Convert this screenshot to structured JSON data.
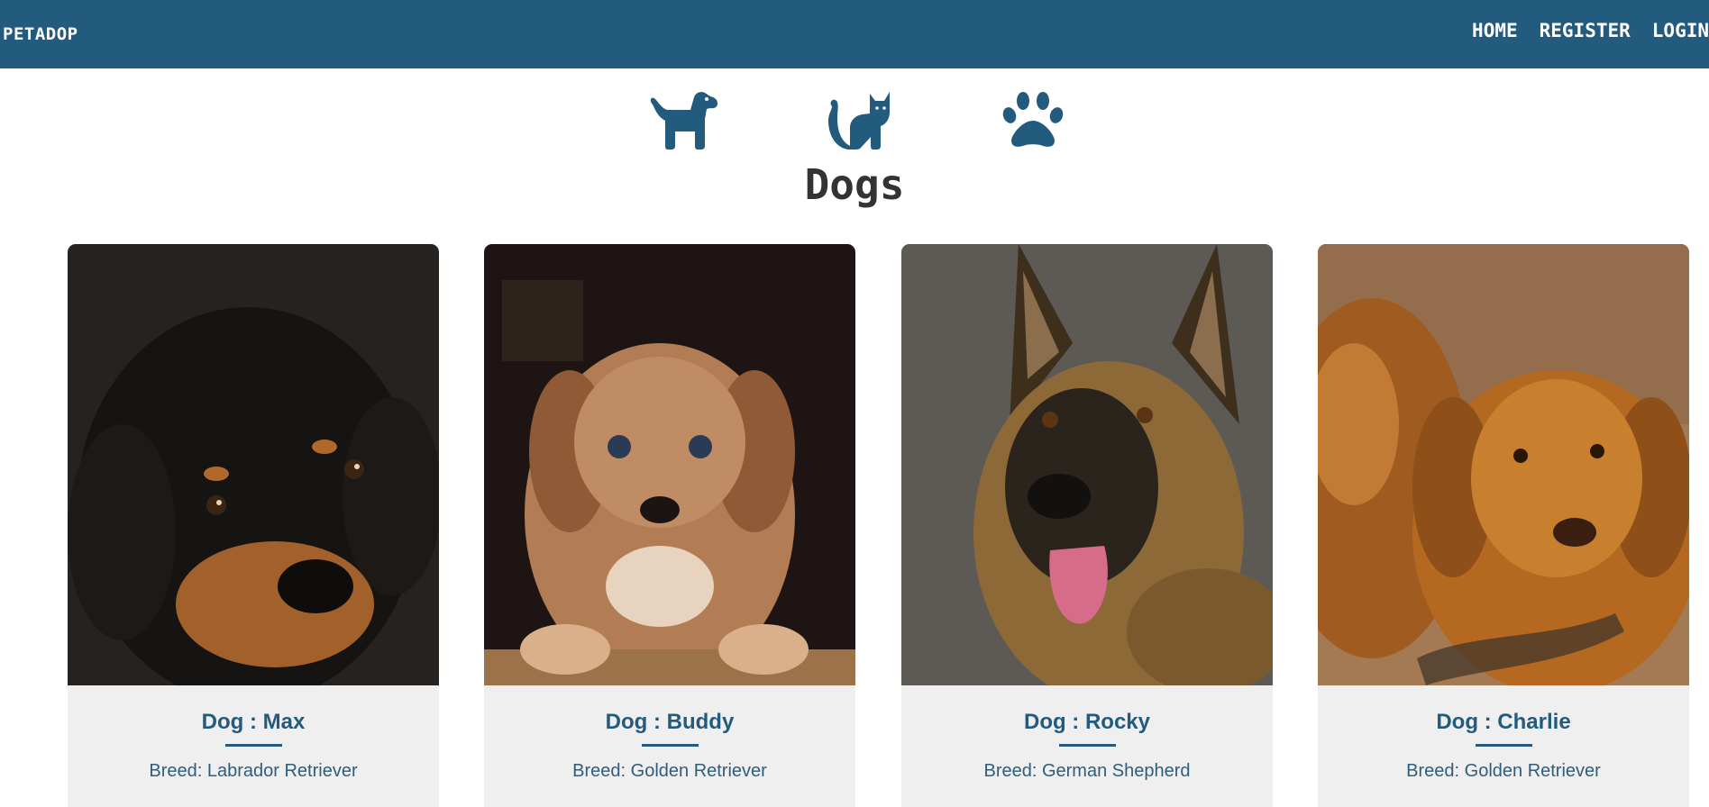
{
  "brand": "PETADOP",
  "nav": {
    "home": "HOME",
    "register": "REGISTER",
    "login": "LOGIN"
  },
  "categories": {
    "dog": "dog-icon",
    "cat": "cat-icon",
    "other": "paw-icon"
  },
  "page_title": "Dogs",
  "colors": {
    "primary": "#235b7e",
    "card_bg": "#efefef",
    "title": "#333333"
  },
  "pets": [
    {
      "name": "Dog : Max",
      "breed": "Breed: Labrador Retriever"
    },
    {
      "name": "Dog : Buddy",
      "breed": "Breed: Golden Retriever"
    },
    {
      "name": "Dog : Rocky",
      "breed": "Breed: German Shepherd"
    },
    {
      "name": "Dog : Charlie",
      "breed": "Breed: Golden Retriever"
    }
  ]
}
